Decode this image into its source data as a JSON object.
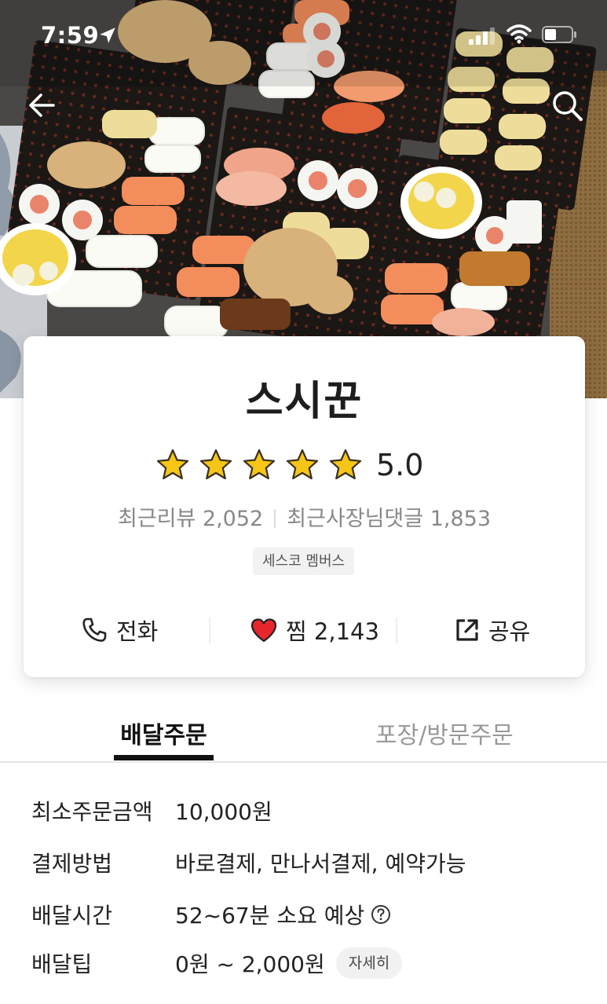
{
  "status_bar": {
    "time": "7:59"
  },
  "header": {
    "back_icon": "arrow-left-icon",
    "search_icon": "search-icon"
  },
  "store": {
    "name": "스시꾼",
    "rating": "5.0",
    "stars": 5,
    "recent_reviews_label": "최근리뷰 2,052",
    "recent_owner_replies_label": "최근사장님댓글 1,853",
    "badge": "세스코 멤버스"
  },
  "actions": {
    "call": "전화",
    "like": "찜 2,143",
    "share": "공유"
  },
  "tabs": [
    {
      "label": "배달주문",
      "active": true
    },
    {
      "label": "포장/방문주문",
      "active": false
    }
  ],
  "info": [
    {
      "label": "최소주문금액",
      "value": "10,000원"
    },
    {
      "label": "결제방법",
      "value": "바로결제, 만나서결제, 예약가능"
    },
    {
      "label": "배달시간",
      "value": "52~67분 소요 예상"
    },
    {
      "label": "배달팁",
      "value": "0원 ~ 2,000원",
      "detail": "자세히"
    }
  ],
  "colors": {
    "heart": "#e8262e",
    "star": "#f5c518",
    "tab_active": "#111111"
  }
}
